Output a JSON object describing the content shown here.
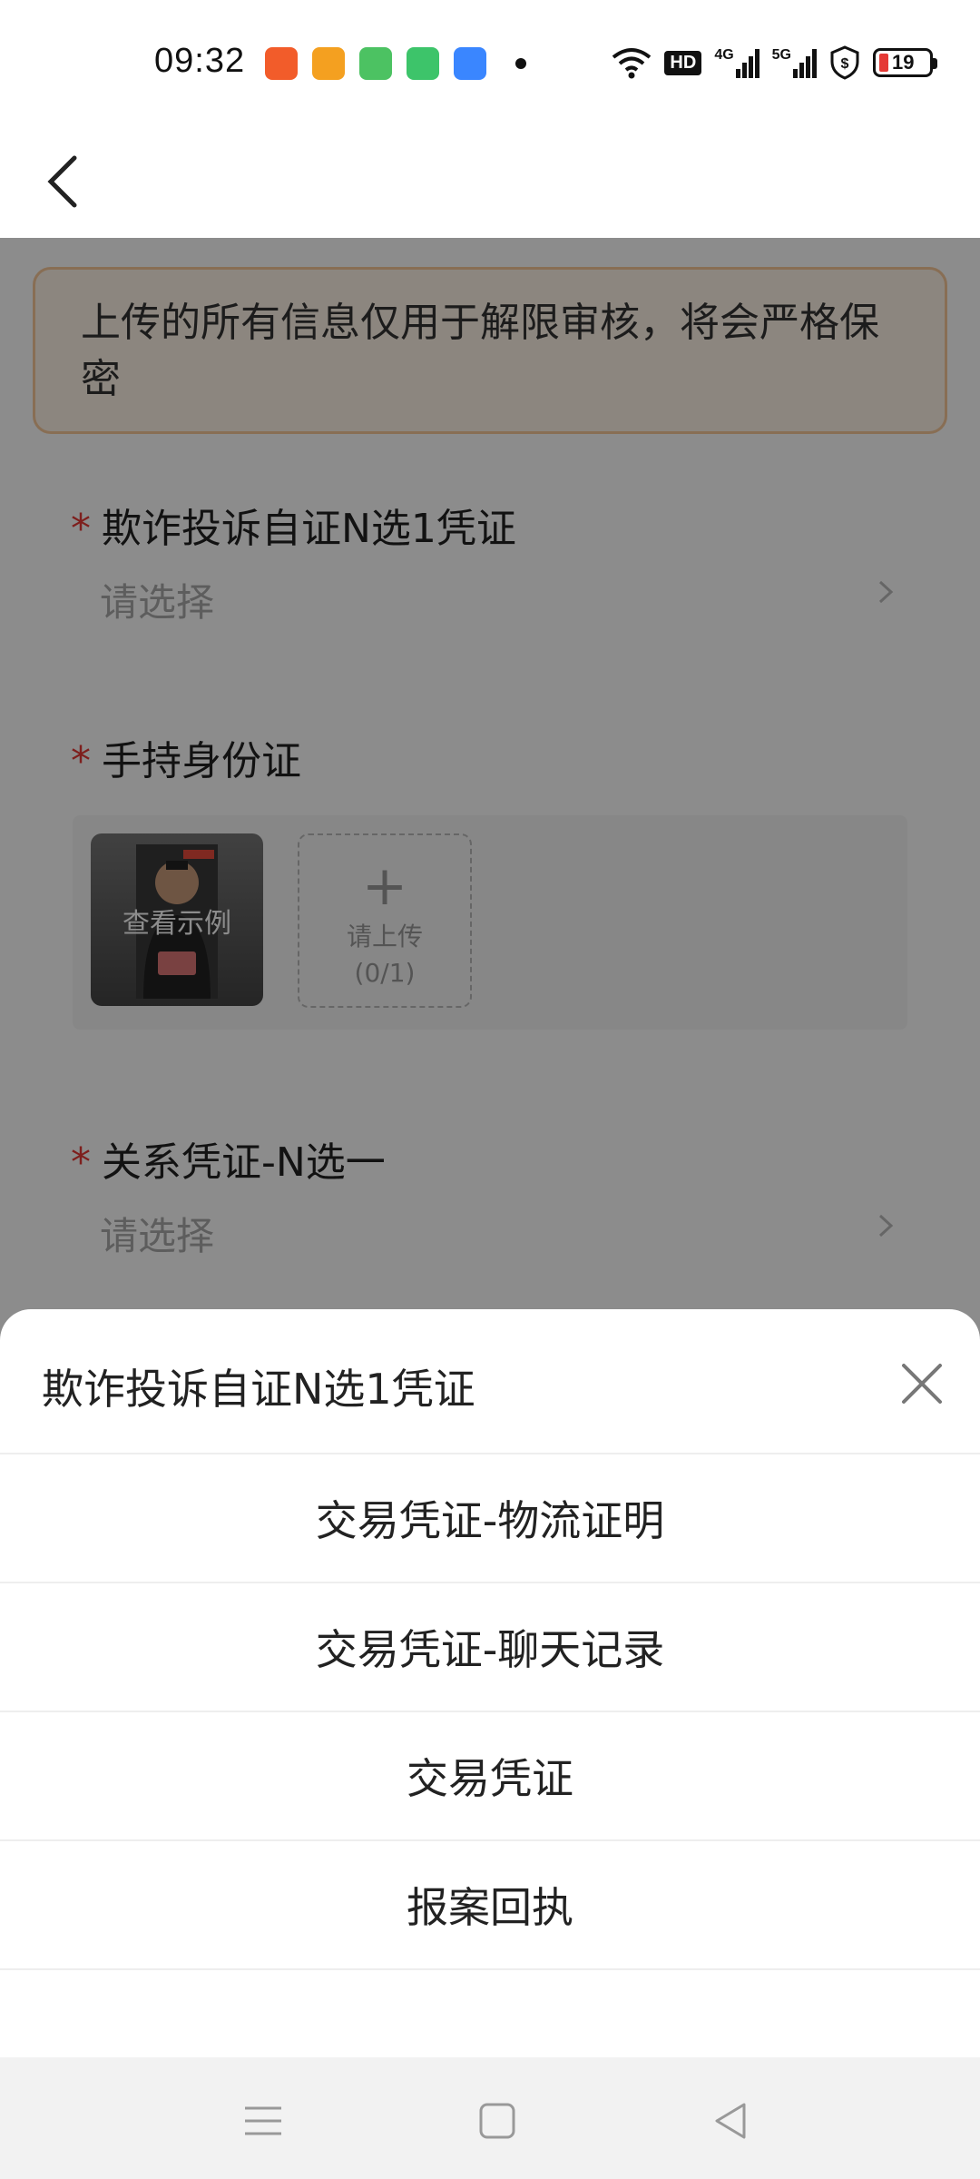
{
  "status_bar": {
    "time": "09:32",
    "network_label": "HD",
    "signal1_label": "4G",
    "signal2_label": "5G",
    "battery_level": "19",
    "notifications": [
      {
        "icon": "app-notification-icon-1",
        "color": "#f25c2a"
      },
      {
        "icon": "app-notification-icon-2",
        "color": "#f4a020"
      },
      {
        "icon": "message-icon",
        "color": "#4cc262"
      },
      {
        "icon": "app-notification-icon-4",
        "color": "#3dc46a"
      },
      {
        "icon": "app-notification-icon-5",
        "color": "#3a86ff"
      }
    ]
  },
  "notice": "上传的所有信息仅用于解限审核，将会严格保密",
  "fields": [
    {
      "label": "欺诈投诉自证N选1凭证",
      "placeholder": "请选择",
      "required": true
    },
    {
      "label": "手持身份证",
      "required": true
    },
    {
      "label": "关系凭证-N选一",
      "placeholder": "请选择",
      "required": true
    }
  ],
  "upload": {
    "example_label": "查看示例",
    "plus": "+",
    "prompt": "请上传",
    "count": "(0/1)"
  },
  "sheet": {
    "title": "欺诈投诉自证N选1凭证",
    "options": [
      "交易凭证-物流证明",
      "交易凭证-聊天记录",
      "交易凭证",
      "报案回执"
    ]
  },
  "colors": {
    "required": "#e53935",
    "notice_bg": "#fff4e8",
    "notice_border": "#f7c89a",
    "overlay": "rgba(0,0,0,0.45)"
  }
}
